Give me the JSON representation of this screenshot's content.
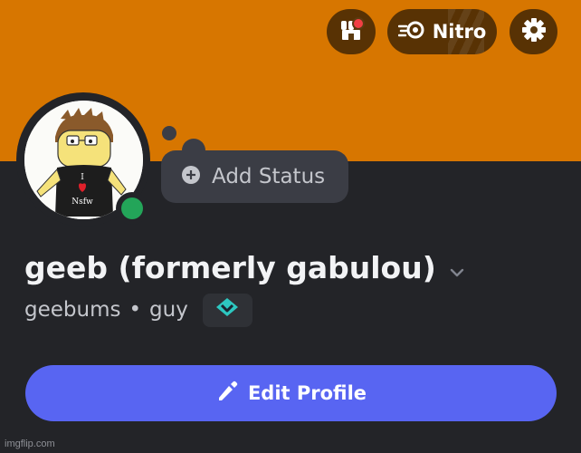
{
  "header": {
    "nitro_label": "Nitro"
  },
  "status": {
    "add_label": "Add Status",
    "online": true
  },
  "profile": {
    "display_name": "geeb (formerly gabulou)",
    "username": "geebums",
    "separator": "•",
    "pronouns": "guy",
    "avatar_shirt_text": [
      "I",
      "Nsfw"
    ]
  },
  "actions": {
    "edit_profile_label": "Edit Profile"
  },
  "watermark": "imgflip.com",
  "colors": {
    "banner": "#d77600",
    "background": "#232428",
    "accent": "#5865f2",
    "online": "#23a559"
  },
  "icons": [
    "shop-icon",
    "nitro-icon",
    "settings-icon",
    "add-status-icon",
    "chevron-down-icon",
    "badge-icon",
    "pencil-icon"
  ]
}
